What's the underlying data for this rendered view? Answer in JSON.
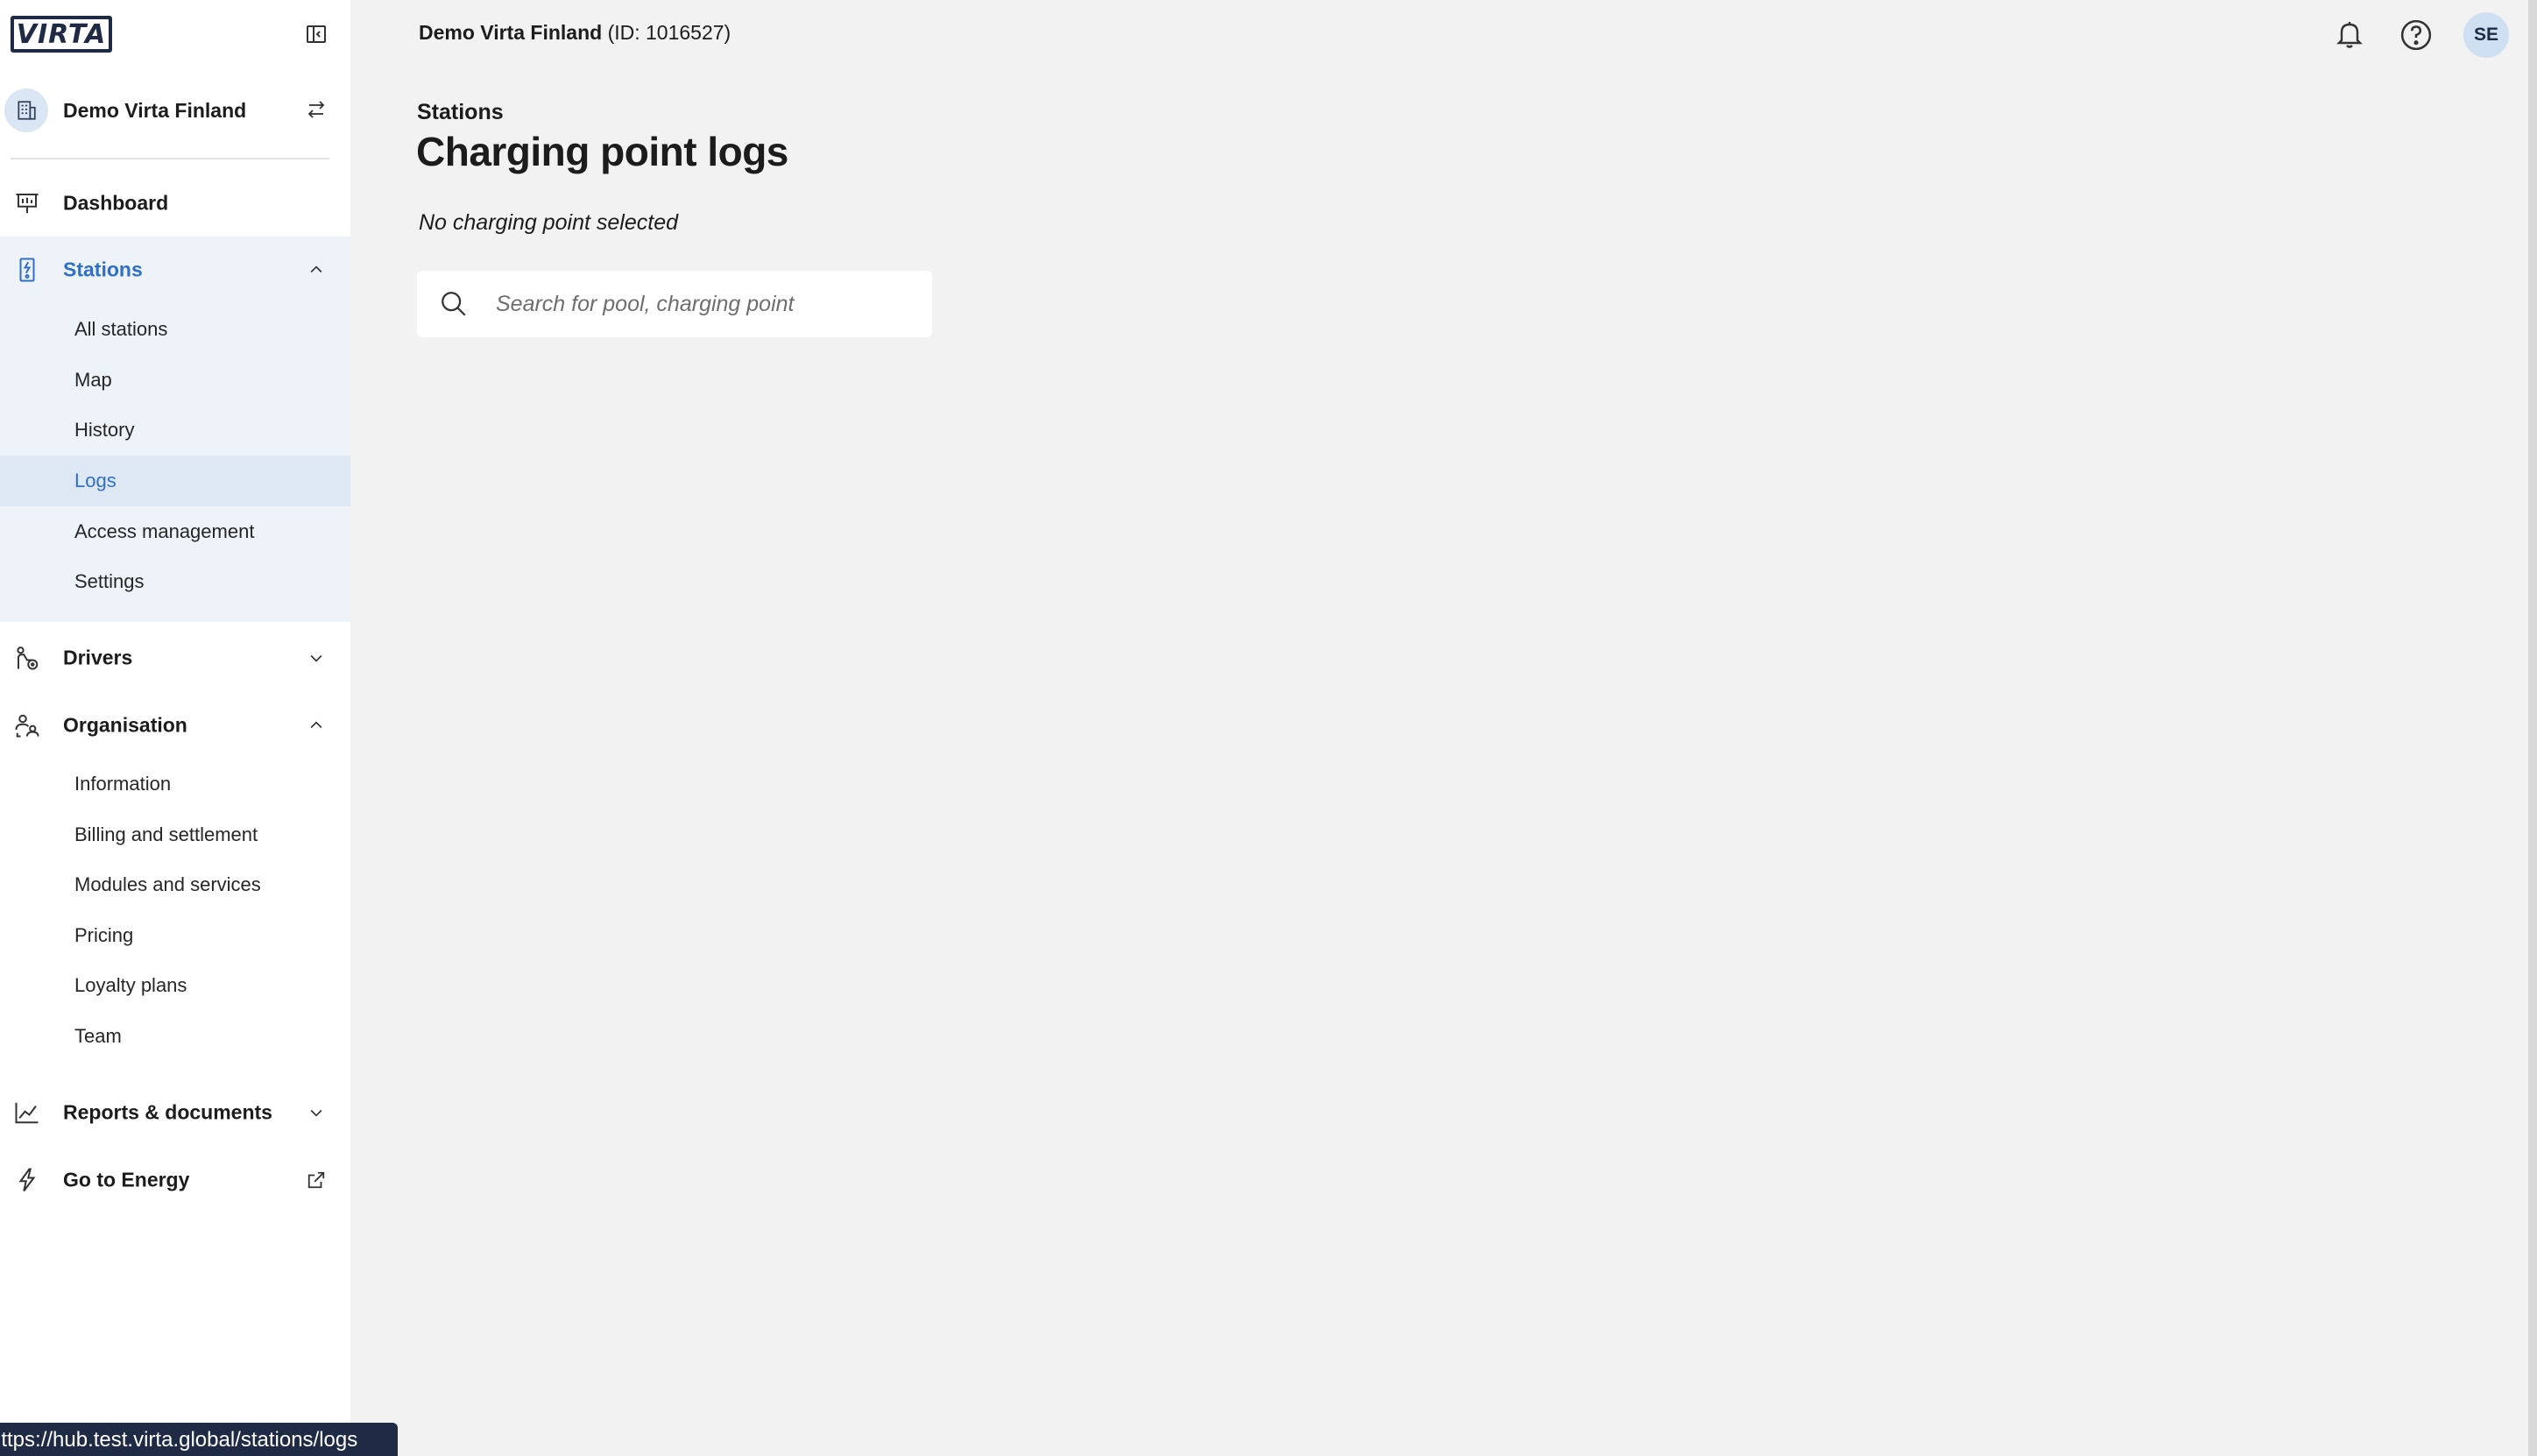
{
  "app": {
    "logo_text": "VIRTA"
  },
  "sidebar": {
    "org_name": "Demo Virta Finland",
    "items": {
      "dashboard": "Dashboard",
      "stations": "Stations",
      "drivers": "Drivers",
      "organisation": "Organisation",
      "reports": "Reports & documents",
      "energy": "Go to Energy"
    },
    "stations_sub": [
      "All stations",
      "Map",
      "History",
      "Logs",
      "Access management",
      "Settings"
    ],
    "organisation_sub": [
      "Information",
      "Billing and settlement",
      "Modules and services",
      "Pricing",
      "Loyalty plans",
      "Team"
    ],
    "selected_sub": "Logs",
    "accent_color": "#2f6fc7"
  },
  "topbar": {
    "org_name": "Demo Virta Finland",
    "org_id": "(ID: 1016527)",
    "user_initials": "SE",
    "icons": [
      "bell-icon",
      "help-icon"
    ]
  },
  "main": {
    "breadcrumb": "Stations",
    "title": "Charging point logs",
    "subtitle": "No charging point selected",
    "search": {
      "placeholder": "Search for pool, charging point",
      "value": ""
    }
  },
  "status_bar": {
    "url": "https://hub.test.virta.global/stations/logs"
  }
}
